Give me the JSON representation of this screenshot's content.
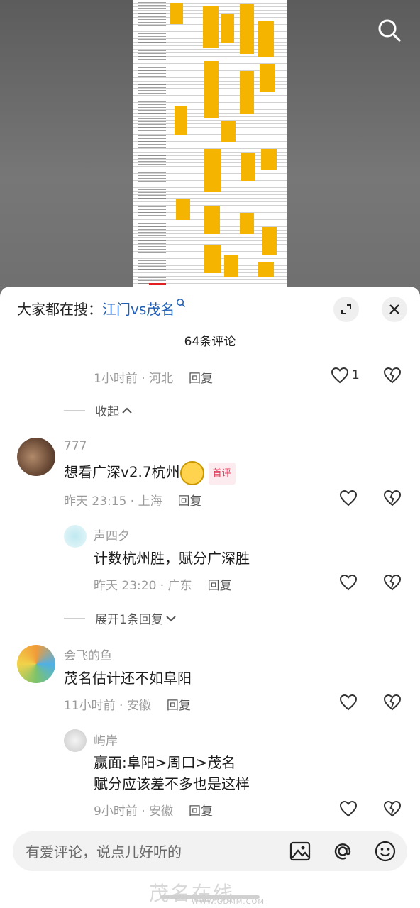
{
  "media": {
    "search_icon": "search-icon"
  },
  "hot_search": {
    "prefix": "大家都在搜：",
    "keyword": "江门vs茂名"
  },
  "header": {
    "count": "64条评论"
  },
  "comments": {
    "c0_meta": {
      "time": "1小时前 · 河北",
      "reply": "回复",
      "likes": "1"
    },
    "collapse": "收起",
    "c1": {
      "user": "777",
      "text": "想看广深v2.7杭州",
      "badge": "首评",
      "time": "昨天 23:15 · 上海",
      "reply": "回复"
    },
    "c1_r1": {
      "user": "声四夕",
      "text": "计数杭州胜，赋分广深胜",
      "time": "昨天 23:20 · 广东",
      "reply": "回复"
    },
    "expand": "展开1条回复",
    "c2": {
      "user": "会飞的鱼",
      "text": "茂名估计还不如阜阳",
      "time": "11小时前 · 安徽",
      "reply": "回复"
    },
    "c2_r1": {
      "user": "屿岸",
      "text1": "赢面:阜阳>周口>茂名",
      "text2": "赋分应该差不多也是这样",
      "time": "9小时前 · 安徽",
      "reply": "回复"
    }
  },
  "input": {
    "placeholder": "有爱评论，说点儿好听的"
  },
  "watermark": {
    "main": "茂名在线",
    "url": "WWW.GDMM.COM"
  },
  "colors": {
    "accent_link": "#1f5fb5",
    "badge": "#e23a5a",
    "cell": "#f5b400"
  }
}
